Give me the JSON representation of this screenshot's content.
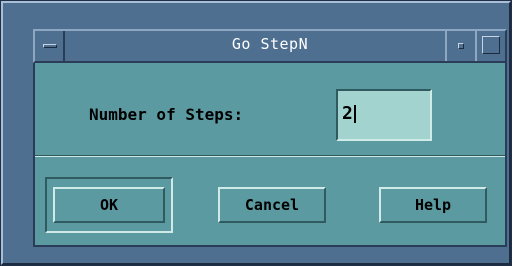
{
  "window": {
    "title": "Go StepN"
  },
  "form": {
    "steps_label": "Number of Steps:",
    "steps_value": "2"
  },
  "buttons": {
    "ok": "OK",
    "cancel": "Cancel",
    "help": "Help"
  },
  "icons": {
    "window_menu": "window-menu-icon",
    "minimize": "minimize-icon",
    "maximize": "maximize-icon"
  },
  "colors": {
    "frame": "#4f6f90",
    "client_background": "#5b9aa0",
    "input_background": "#a3d3ce",
    "title_text": "#ffffff"
  }
}
